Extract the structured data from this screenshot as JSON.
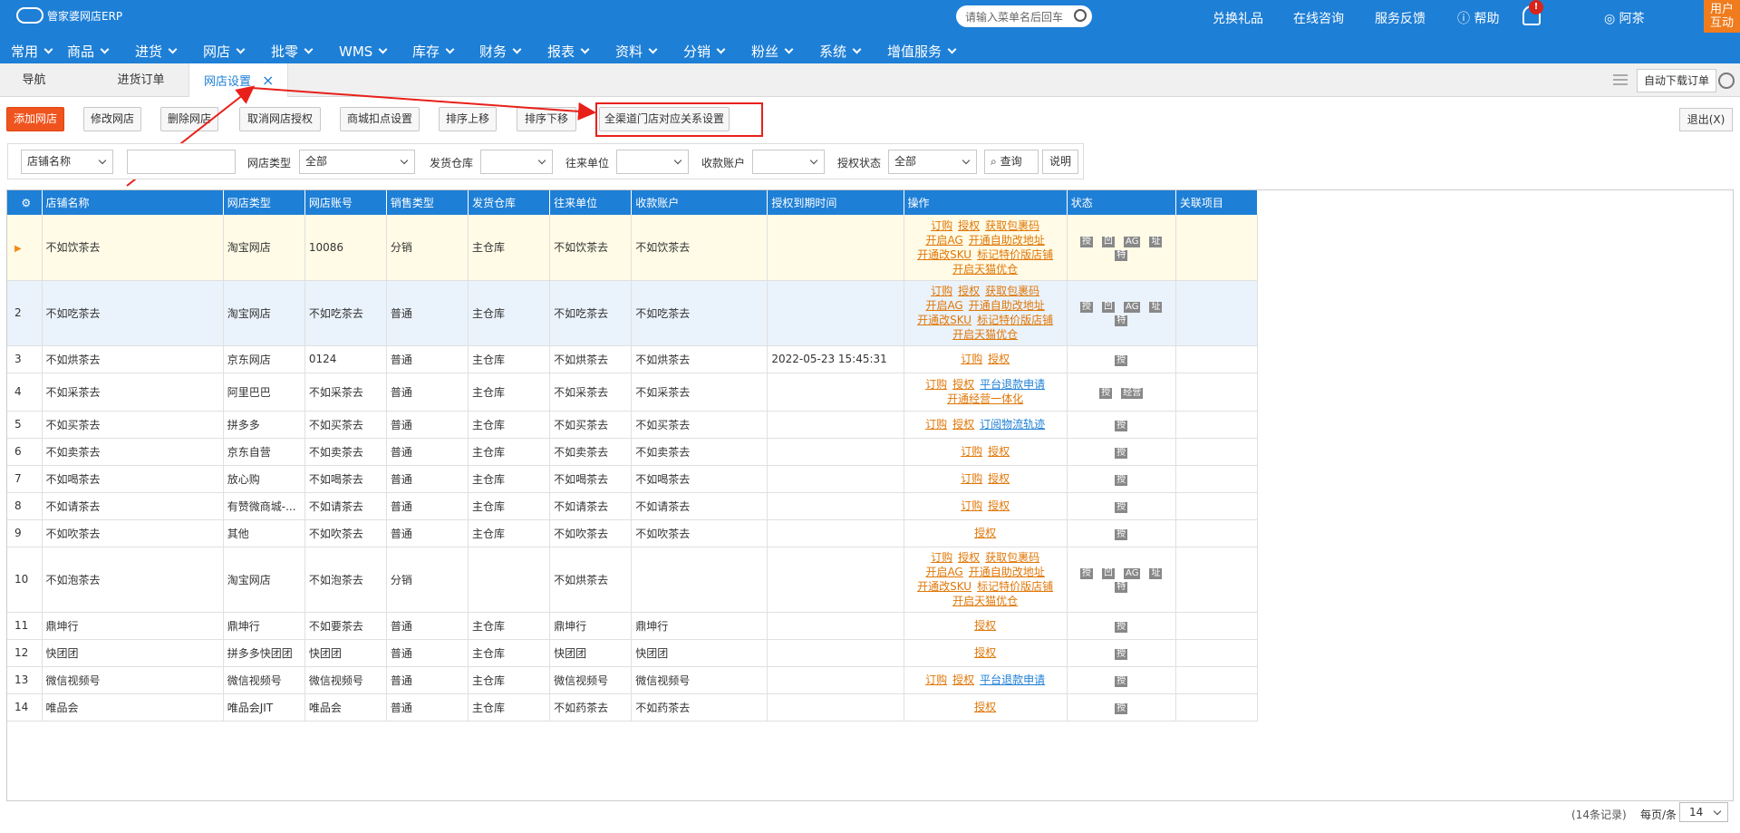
{
  "app": {
    "logo_text": "管家婆网店ERP",
    "search_placeholder": "请输入菜单名后回车"
  },
  "top_links": [
    "兑换礼品",
    "在线咨询",
    "服务反馈",
    "帮助"
  ],
  "bell_badge": "!",
  "user": {
    "name": "阿茶",
    "block_line1": "用户",
    "block_line2": "互动"
  },
  "menu": [
    "常用",
    "商品",
    "进货",
    "网店",
    "批零",
    "WMS",
    "库存",
    "财务",
    "报表",
    "资料",
    "分销",
    "粉丝",
    "系统",
    "增值服务"
  ],
  "tabs": {
    "nav": "导航",
    "purchase_orders": "进货订单",
    "shop_settings": "网店设置",
    "close": "×"
  },
  "auto_download": "自动下载订单",
  "toolbar": {
    "add_shop": "添加网店",
    "edit_shop": "修改网店",
    "delete_shop": "删除网店",
    "cancel_auth": "取消网店授权",
    "mall_deduction": "商城扣点设置",
    "sort_up": "排序上移",
    "sort_down": "排序下移",
    "channel_mapping": "全渠道门店对应关系设置",
    "exit": "退出(X)"
  },
  "filters": {
    "field_select": "店铺名称",
    "shop_type_label": "网店类型",
    "shop_type_value": "全部",
    "warehouse_label": "发货仓库",
    "partner_label": "往来单位",
    "account_label": "收款账户",
    "auth_status_label": "授权状态",
    "auth_status_value": "全部",
    "query": "查询",
    "explain": "说明"
  },
  "table": {
    "headers": [
      "店铺名称",
      "网店类型",
      "网店账号",
      "销售类型",
      "发货仓库",
      "往来单位",
      "收款账户",
      "授权到期时间",
      "操作",
      "状态",
      "关联项目"
    ],
    "rows": [
      {
        "no": "",
        "name": "不如饮茶去",
        "type": "淘宝网店",
        "account": "10086",
        "sale": "分销",
        "wh": "主仓库",
        "partner": "不如饮茶去",
        "pay": "不如饮茶去",
        "exp": "",
        "ops": [
          "订购",
          "授权",
          "获取包裹码",
          "开启AG",
          "开通自助改地址",
          "开通改SKU",
          "标记特价版店铺",
          "开启天猫优仓"
        ],
        "status": [
          "授",
          "凹",
          "AG",
          "址",
          "特"
        ]
      },
      {
        "no": "2",
        "name": "不如吃茶去",
        "type": "淘宝网店",
        "account": "不如吃茶去",
        "sale": "普通",
        "wh": "主仓库",
        "partner": "不如吃茶去",
        "pay": "不如吃茶去",
        "exp": "",
        "ops": [
          "订购",
          "授权",
          "获取包裹码",
          "开启AG",
          "开通自助改地址",
          "开通改SKU",
          "标记特价版店铺",
          "开启天猫优仓"
        ],
        "status": [
          "授",
          "凹",
          "AG",
          "址",
          "特"
        ]
      },
      {
        "no": "3",
        "name": "不如烘茶去",
        "type": "京东网店",
        "account": "0124",
        "sale": "普通",
        "wh": "主仓库",
        "partner": "不如烘茶去",
        "pay": "不如烘茶去",
        "exp": "2022-05-23 15:45:31",
        "ops": [
          "订购",
          "授权"
        ],
        "status": [
          "授"
        ]
      },
      {
        "no": "4",
        "name": "不如采茶去",
        "type": "阿里巴巴",
        "account": "不如采茶去",
        "sale": "普通",
        "wh": "主仓库",
        "partner": "不如采茶去",
        "pay": "不如采茶去",
        "exp": "",
        "ops": [
          "订购",
          "授权",
          "平台退款申请",
          "开通经营一体化"
        ],
        "status": [
          "授",
          "经营"
        ]
      },
      {
        "no": "5",
        "name": "不如买茶去",
        "type": "拼多多",
        "account": "不如买茶去",
        "sale": "普通",
        "wh": "主仓库",
        "partner": "不如买茶去",
        "pay": "不如买茶去",
        "exp": "",
        "ops": [
          "订购",
          "授权",
          "订阅物流轨迹"
        ],
        "status": [
          "授"
        ]
      },
      {
        "no": "6",
        "name": "不如卖茶去",
        "type": "京东自营",
        "account": "不如卖茶去",
        "sale": "普通",
        "wh": "主仓库",
        "partner": "不如卖茶去",
        "pay": "不如卖茶去",
        "exp": "",
        "ops": [
          "订购",
          "授权"
        ],
        "status": [
          "授"
        ]
      },
      {
        "no": "7",
        "name": "不如喝茶去",
        "type": "放心购",
        "account": "不如喝茶去",
        "sale": "普通",
        "wh": "主仓库",
        "partner": "不如喝茶去",
        "pay": "不如喝茶去",
        "exp": "",
        "ops": [
          "订购",
          "授权"
        ],
        "status": [
          "授"
        ]
      },
      {
        "no": "8",
        "name": "不如请茶去",
        "type": "有赞微商城-...",
        "account": "不如请茶去",
        "sale": "普通",
        "wh": "主仓库",
        "partner": "不如请茶去",
        "pay": "不如请茶去",
        "exp": "",
        "ops": [
          "订购",
          "授权"
        ],
        "status": [
          "授"
        ]
      },
      {
        "no": "9",
        "name": "不如吹茶去",
        "type": "其他",
        "account": "不如吹茶去",
        "sale": "普通",
        "wh": "主仓库",
        "partner": "不如吹茶去",
        "pay": "不如吹茶去",
        "exp": "",
        "ops": [
          "授权"
        ],
        "status": [
          "授"
        ]
      },
      {
        "no": "10",
        "name": "不如泡茶去",
        "type": "淘宝网店",
        "account": "不如泡茶去",
        "sale": "分销",
        "wh": "",
        "partner": "不如烘茶去",
        "pay": "",
        "exp": "",
        "ops": [
          "订购",
          "授权",
          "获取包裹码",
          "开启AG",
          "开通自助改地址",
          "开通改SKU",
          "标记特价版店铺",
          "开启天猫优仓"
        ],
        "status": [
          "授",
          "凹",
          "AG",
          "址",
          "特"
        ]
      },
      {
        "no": "11",
        "name": "鼎坤行",
        "type": "鼎坤行",
        "account": "不如要茶去",
        "sale": "普通",
        "wh": "主仓库",
        "partner": "鼎坤行",
        "pay": "鼎坤行",
        "exp": "",
        "ops": [
          "授权"
        ],
        "status": [
          "授"
        ]
      },
      {
        "no": "12",
        "name": "快团团",
        "type": "拼多多快团团",
        "account": "快团团",
        "sale": "普通",
        "wh": "主仓库",
        "partner": "快团团",
        "pay": "快团团",
        "exp": "",
        "ops": [
          "授权"
        ],
        "status": [
          "授"
        ]
      },
      {
        "no": "13",
        "name": "微信视频号",
        "type": "微信视频号",
        "account": "微信视频号",
        "sale": "普通",
        "wh": "主仓库",
        "partner": "微信视频号",
        "pay": "微信视频号",
        "exp": "",
        "ops": [
          "订购",
          "授权",
          "平台退款申请"
        ],
        "status": [
          "授"
        ]
      },
      {
        "no": "14",
        "name": "唯品会",
        "type": "唯品会JIT",
        "account": "唯品会",
        "sale": "普通",
        "wh": "主仓库",
        "partner": "不如药茶去",
        "pay": "不如药茶去",
        "exp": "",
        "ops": [
          "授权"
        ],
        "status": [
          "授"
        ]
      }
    ]
  },
  "footer": {
    "records": "(14条记录)",
    "per_page_label": "每页/条",
    "per_page": "14"
  },
  "colors": {
    "brand": "#1e7fd6",
    "orange": "#f0541e",
    "annotation_red": "#e8201a"
  }
}
